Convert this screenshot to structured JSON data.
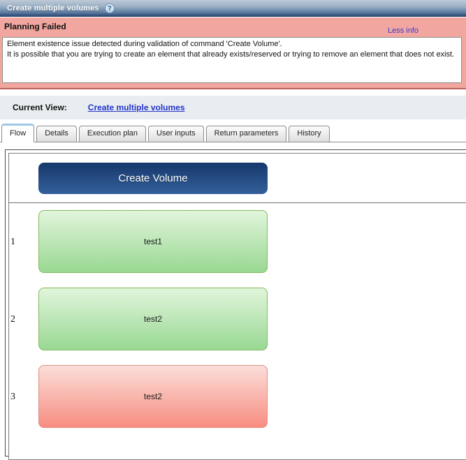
{
  "window": {
    "title": "Create multiple volumes",
    "help_icon_glyph": "?"
  },
  "error_banner": {
    "title": "Planning Failed",
    "toggle_link": "Less info",
    "message_line1": "Element existence issue detected during validation of command 'Create Volume'.",
    "message_line2": "It is possible that you are trying to create an element that already exists/reserved or trying to remove an element that does not exist."
  },
  "current_view": {
    "label": "Current View:",
    "link": "Create multiple volumes"
  },
  "tabs": [
    {
      "label": "Flow",
      "active": true
    },
    {
      "label": "Details",
      "active": false
    },
    {
      "label": "Execution plan",
      "active": false
    },
    {
      "label": "User inputs",
      "active": false
    },
    {
      "label": "Return parameters",
      "active": false
    },
    {
      "label": "History",
      "active": false
    }
  ],
  "flow": {
    "header_node": "Create Volume",
    "rows": [
      {
        "index": "1",
        "label": "test1",
        "status": "success"
      },
      {
        "index": "2",
        "label": "test2",
        "status": "success"
      },
      {
        "index": "3",
        "label": "test2",
        "status": "failed"
      }
    ]
  },
  "colors": {
    "banner_pink": "#f1a69f",
    "banner_border": "#b4625d",
    "link_blue": "#2433cc",
    "less_info_blue": "#3a3ad4",
    "header_node_top": "#17386b",
    "header_node_bottom": "#33609b",
    "success_top": "#e1f5dc",
    "success_bottom": "#99d892",
    "success_border": "#85ba5e",
    "failed_top": "#fbdeda",
    "failed_bottom": "#f78d80",
    "failed_border": "#e18f7e",
    "current_view_bg": "#e8edf0"
  }
}
